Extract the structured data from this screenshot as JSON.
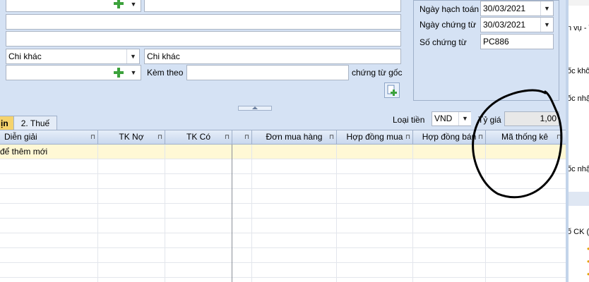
{
  "form": {
    "obj_value": "",
    "obj_name": "",
    "address": "",
    "reason_text": "",
    "reason_select": "Chi khác",
    "reason_desc": "Chi khác",
    "kem_theo_label": "Kèm theo",
    "kem_theo_value": "",
    "chung_tu_goc_label": "chứng từ gốc"
  },
  "dates": {
    "ngay_hach_toan_label": "Ngày hạch toán",
    "ngay_hach_toan": "30/03/2021",
    "ngay_chung_tu_label": "Ngày chứng từ",
    "ngay_chung_tu": "30/03/2021",
    "so_chung_tu_label": "Số chứng từ",
    "so_chung_tu": "PC886"
  },
  "tabs": [
    {
      "label": "ịn"
    },
    {
      "label": "2. Thuế"
    }
  ],
  "currency": {
    "label": "Loại tiền",
    "value": "VND",
    "rate_label": "Tỷ giá",
    "rate": "1,00"
  },
  "grid": {
    "columns": [
      "Diễn giải",
      "TK Nợ",
      "TK Có",
      "Đơn mua hàng",
      "Hợp đồng mua",
      "Hợp đồng bán",
      "Mã thống kê"
    ],
    "new_row_hint": "để thêm mới"
  },
  "right_strip": {
    "items": [
      "n vụ  -  T",
      "ốc khô",
      "ốc nhậ",
      "ốc nhậ",
      "ố CK (%"
    ]
  }
}
